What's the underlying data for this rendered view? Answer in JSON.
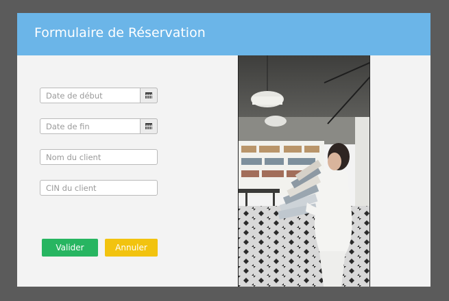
{
  "window": {
    "title": "Formulaire de Réservation"
  },
  "form": {
    "start_date": {
      "placeholder": "Date de début"
    },
    "end_date": {
      "placeholder": "Date de fin"
    },
    "client_name": {
      "placeholder": "Nom du client"
    },
    "client_cin": {
      "placeholder": "CIN du client"
    },
    "validate_label": "Valider",
    "cancel_label": "Annuler"
  },
  "colors": {
    "header": "#6bb5e8",
    "validate": "#27b561",
    "cancel": "#f2c30f"
  },
  "icons": {
    "calendar": "calendar-icon"
  }
}
